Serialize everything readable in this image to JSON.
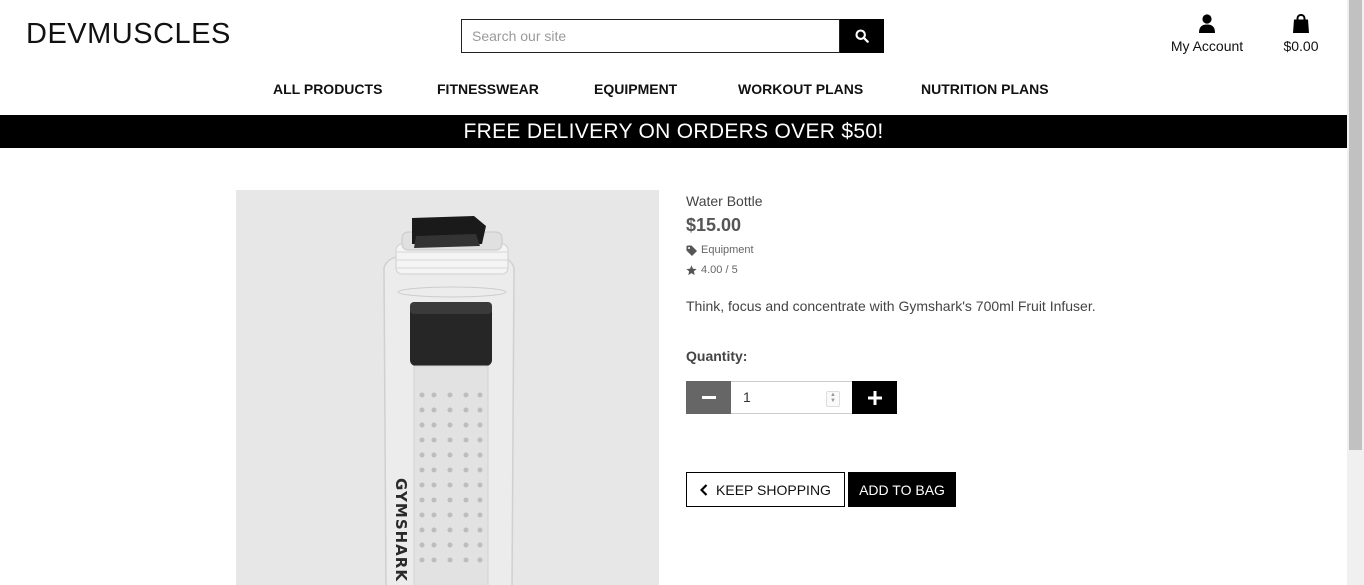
{
  "header": {
    "logo": "DEVMUSCLES",
    "search_placeholder": "Search our site",
    "account_label": "My Account",
    "bag_total": "$0.00"
  },
  "nav": {
    "items": [
      "ALL PRODUCTS",
      "FITNESSWEAR",
      "EQUIPMENT",
      "WORKOUT PLANS",
      "NUTRITION PLANS"
    ]
  },
  "banner": "FREE DELIVERY ON ORDERS OVER $50!",
  "product": {
    "name": "Water Bottle",
    "price": "$15.00",
    "category": "Equipment",
    "rating": "4.00 / 5",
    "description": "Think, focus and concentrate with Gymshark's 700ml Fruit Infuser.",
    "image_text": "GYMSHARK"
  },
  "quantity": {
    "label": "Quantity:",
    "value": "1"
  },
  "actions": {
    "keep_shopping": "KEEP SHOPPING",
    "add_to_bag": "ADD TO BAG"
  }
}
